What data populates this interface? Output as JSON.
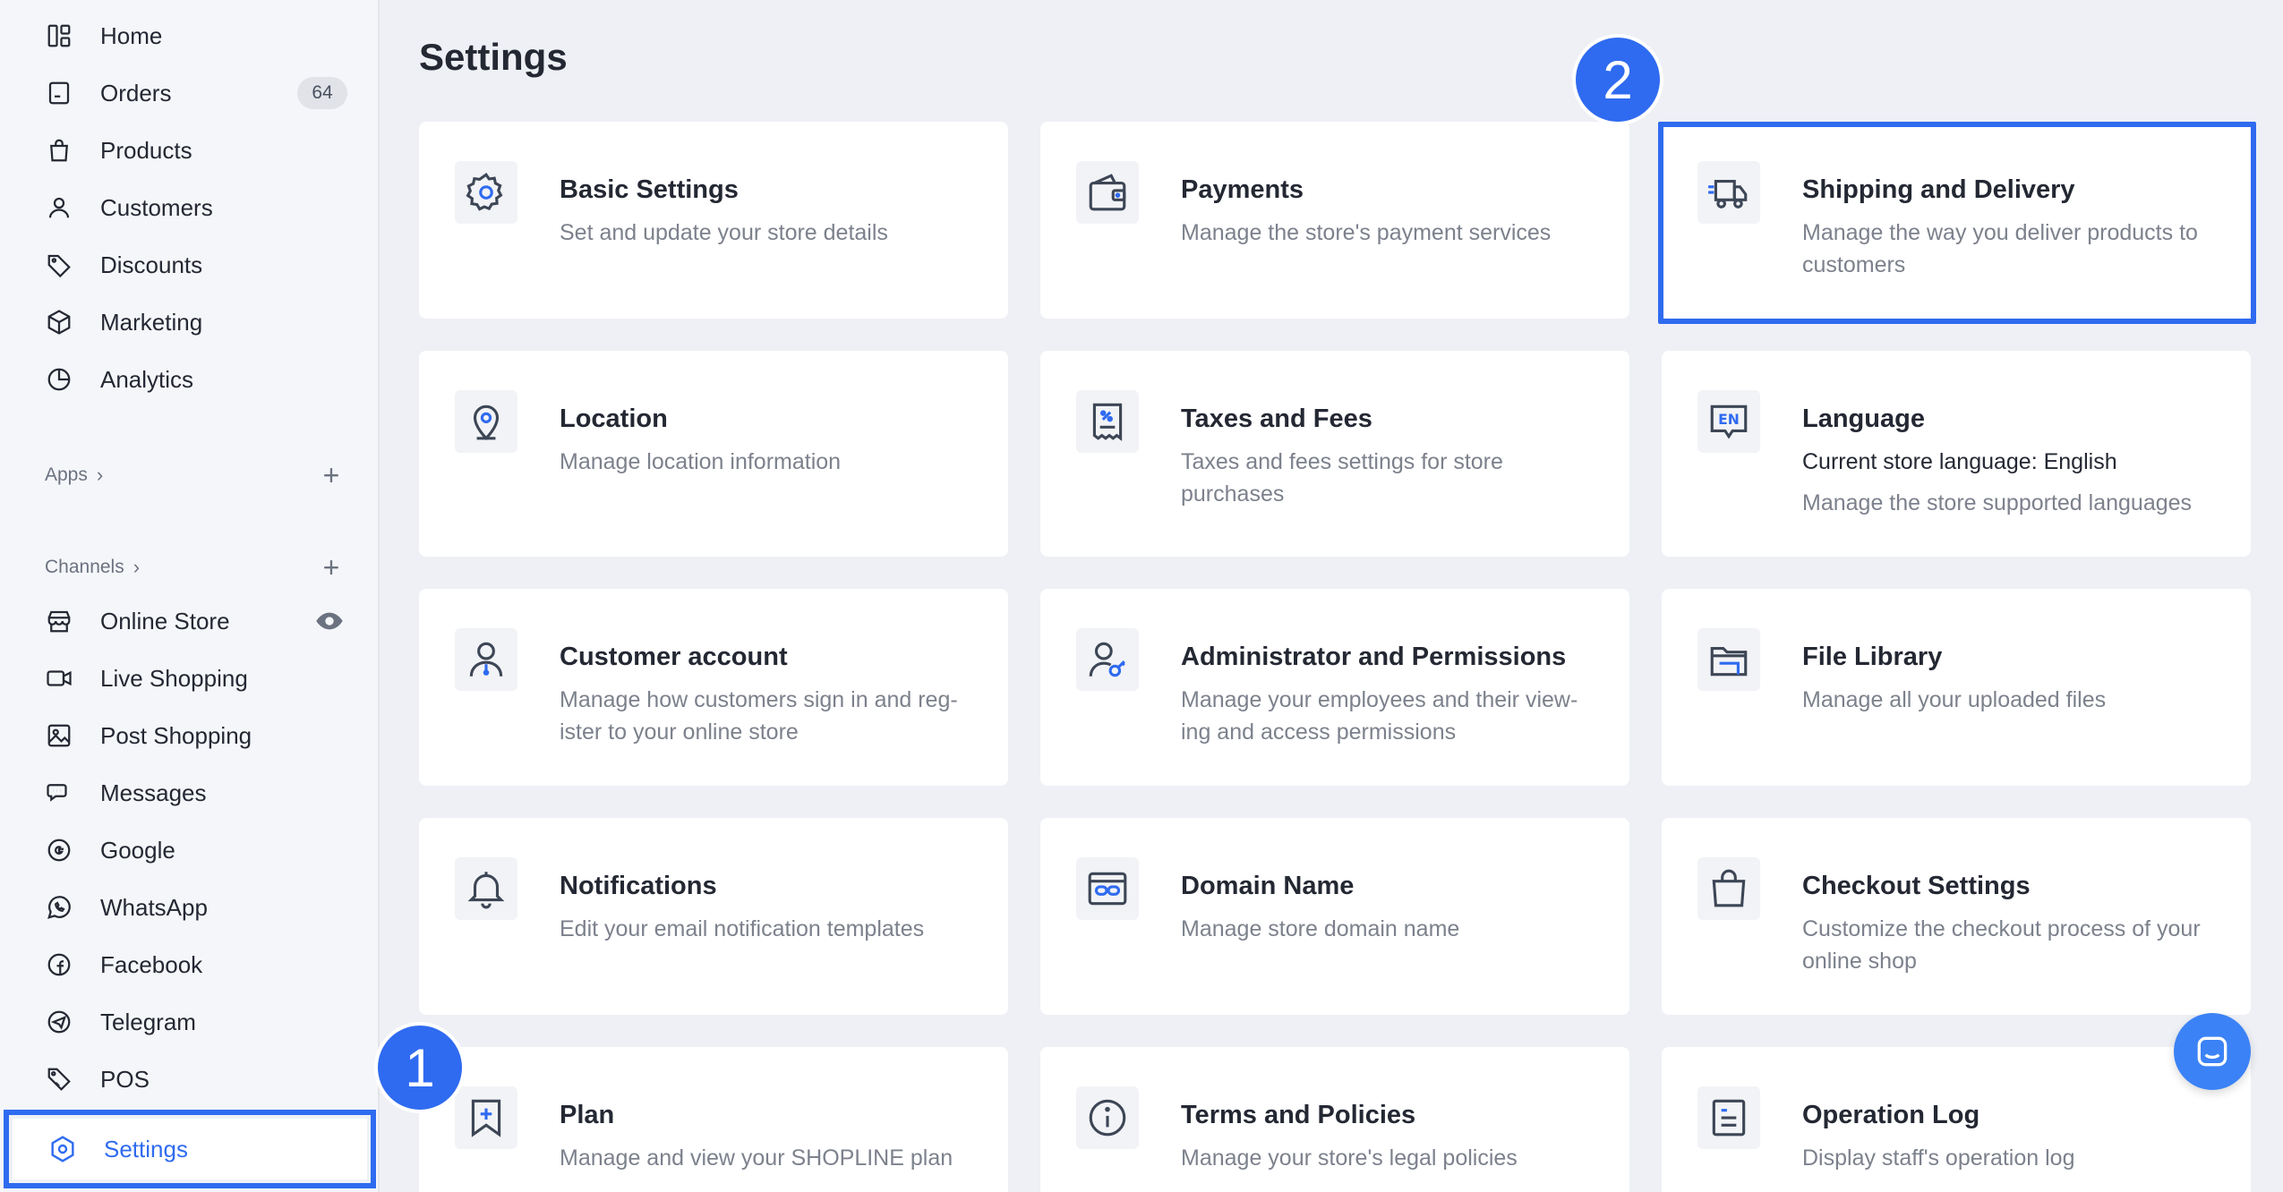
{
  "sidebar": {
    "items": [
      {
        "label": "Home",
        "icon": "dashboard-icon"
      },
      {
        "label": "Orders",
        "icon": "orders-icon",
        "badge": "64"
      },
      {
        "label": "Products",
        "icon": "products-bag-icon"
      },
      {
        "label": "Customers",
        "icon": "customer-person-icon"
      },
      {
        "label": "Discounts",
        "icon": "tag-icon"
      },
      {
        "label": "Marketing",
        "icon": "cube-icon"
      },
      {
        "label": "Analytics",
        "icon": "pie-chart-icon"
      }
    ],
    "apps_label": "Apps",
    "channels_label": "Channels",
    "channels": [
      {
        "label": "Online Store",
        "icon": "store-icon"
      },
      {
        "label": "Live Shopping",
        "icon": "video-camera-icon"
      },
      {
        "label": "Post Shopping",
        "icon": "image-icon"
      },
      {
        "label": "Messages",
        "icon": "chat-bubbles-icon"
      },
      {
        "label": "Google",
        "icon": "google-icon"
      },
      {
        "label": "WhatsApp",
        "icon": "whatsapp-icon"
      },
      {
        "label": "Facebook",
        "icon": "facebook-icon"
      },
      {
        "label": "Telegram",
        "icon": "telegram-icon"
      },
      {
        "label": "POS",
        "icon": "pos-tag-icon"
      }
    ],
    "settings_label": "Settings"
  },
  "main": {
    "title": "Settings",
    "cards": [
      {
        "title": "Basic Settings",
        "desc": "Set and update your store details",
        "icon": "gear-icon"
      },
      {
        "title": "Payments",
        "desc": "Manage the store's payment services",
        "icon": "wallet-icon"
      },
      {
        "title": "Shipping and Delivery",
        "desc": "Manage the way you deliver products to customers",
        "icon": "truck-icon"
      },
      {
        "title": "Location",
        "desc": "Manage location information",
        "icon": "location-pin-icon"
      },
      {
        "title": "Taxes and Fees",
        "desc": "Taxes and fees settings for store purchases",
        "icon": "receipt-icon"
      },
      {
        "title": "Language",
        "desc_current": "Current store language: English",
        "desc": "Manage the store supported languages",
        "icon": "language-en-icon",
        "icon_text": "EN"
      },
      {
        "title": "Customer account",
        "desc": "Manage how customers sign in and reg-ister to your online store",
        "icon": "customer-account-icon"
      },
      {
        "title": "Administrator and Permissions",
        "desc": "Manage your employees and their view-ing and access permissions",
        "icon": "admin-key-icon"
      },
      {
        "title": "File Library",
        "desc": "Manage all your uploaded files",
        "icon": "folder-icon"
      },
      {
        "title": "Notifications",
        "desc": "Edit your email notification templates",
        "icon": "bell-icon"
      },
      {
        "title": "Domain Name",
        "desc": "Manage store domain name",
        "icon": "domain-link-icon"
      },
      {
        "title": "Checkout Settings",
        "desc": "Customize the checkout process of your online shop",
        "icon": "shopping-bag-icon"
      },
      {
        "title": "Plan",
        "desc": "Manage and view your SHOPLINE plan",
        "icon": "bookmark-plus-icon"
      },
      {
        "title": "Terms and Policies",
        "desc": "Manage your store's legal policies",
        "icon": "info-icon"
      },
      {
        "title": "Operation Log",
        "desc": "Display staff's operation log",
        "icon": "log-document-icon"
      }
    ]
  },
  "annotations": {
    "step1": "1",
    "step2": "2"
  },
  "colors": {
    "accent": "#2f6bf0",
    "background": "#eef0f5",
    "card": "#ffffff",
    "muted_text": "#7c818c"
  }
}
